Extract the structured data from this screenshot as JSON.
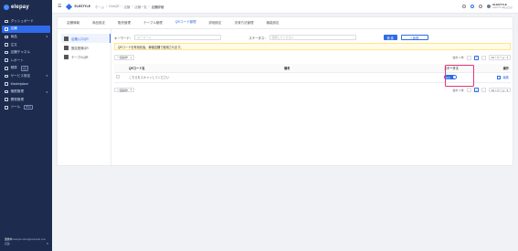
{
  "brand": {
    "name": "elepay"
  },
  "sidebar": {
    "items": [
      {
        "label": "ダッシュボード",
        "icon": "dashboard-icon",
        "active": false
      },
      {
        "label": "店舗",
        "icon": "store-icon",
        "active": true
      },
      {
        "label": "商品",
        "icon": "product-icon",
        "active": false,
        "caret": true
      },
      {
        "label": "注文",
        "icon": "order-icon",
        "active": false
      },
      {
        "label": "店舗チャネル",
        "icon": "channel-icon",
        "active": false
      },
      {
        "label": "レポート",
        "icon": "report-icon",
        "active": false
      },
      {
        "label": "精算",
        "icon": "settlement-icon",
        "active": false,
        "badge": "β版"
      },
      {
        "label": "サービス設定",
        "icon": "service-icon",
        "active": false,
        "caret": true
      },
      {
        "label": "Marketplace",
        "icon": "marketplace-icon",
        "active": false
      },
      {
        "label": "権限管理",
        "icon": "permission-icon",
        "active": false,
        "caret": true
      },
      {
        "label": "開発管理",
        "icon": "dev-icon",
        "active": false
      },
      {
        "label": "ツール",
        "icon": "tool-icon",
        "active": false,
        "badge": "Beta"
      }
    ],
    "footer": {
      "label": "運営中",
      "email": "elestyle.store@example.com",
      "plan": "店舗"
    }
  },
  "topbar": {
    "store": "ELESTYLE",
    "breadcrumbs": [
      "ホーム",
      "OneQR",
      "店舗",
      "店舗一覧",
      "店舗詳細"
    ],
    "account_name": "ELESTYLE",
    "account_sub": "ELESTYLE株式会社"
  },
  "tabs": [
    {
      "label": "店舗情報",
      "active": false
    },
    {
      "label": "商品設定",
      "active": false
    },
    {
      "label": "販売管理",
      "active": false
    },
    {
      "label": "テーブル管理",
      "active": false
    },
    {
      "label": "QRコード管理",
      "active": true
    },
    {
      "label": "詳細設定",
      "active": false
    },
    {
      "label": "決済方法管理",
      "active": false
    },
    {
      "label": "機能設定",
      "active": false
    }
  ],
  "subnav": [
    {
      "label": "店舗入口QR",
      "icon": "qr-store-icon",
      "active": true
    },
    {
      "label": "固定座席QR",
      "icon": "qr-seat-icon",
      "active": false
    },
    {
      "label": "テーブルQR",
      "icon": "qr-table-icon",
      "active": false
    }
  ],
  "filters": {
    "keyword_label": "キーワード：",
    "keyword_placeholder": "キーワード",
    "status_label": "ステータス：",
    "status_placeholder": "選択してください",
    "search_button": "検 索",
    "add_button": "+ 新規"
  },
  "notice": "QRコードを有効化後、稼働店舗で使用されます。",
  "toolbar": {
    "bulk_label": "一括操作",
    "total_label": "合計 1 件",
    "page": "1",
    "per_page": "10 / ページ"
  },
  "table": {
    "headers": [
      "QRコード名",
      "備考",
      "ステータス",
      "操作"
    ],
    "rows": [
      {
        "name": "こちらをスキャンしてください",
        "note": "",
        "status": "有効",
        "action": "編集"
      }
    ]
  },
  "colors": {
    "primary": "#2f6bea",
    "sidebar": "#1d2b4f",
    "highlight": "#e8307b",
    "notice_bg": "#fffbe6"
  }
}
